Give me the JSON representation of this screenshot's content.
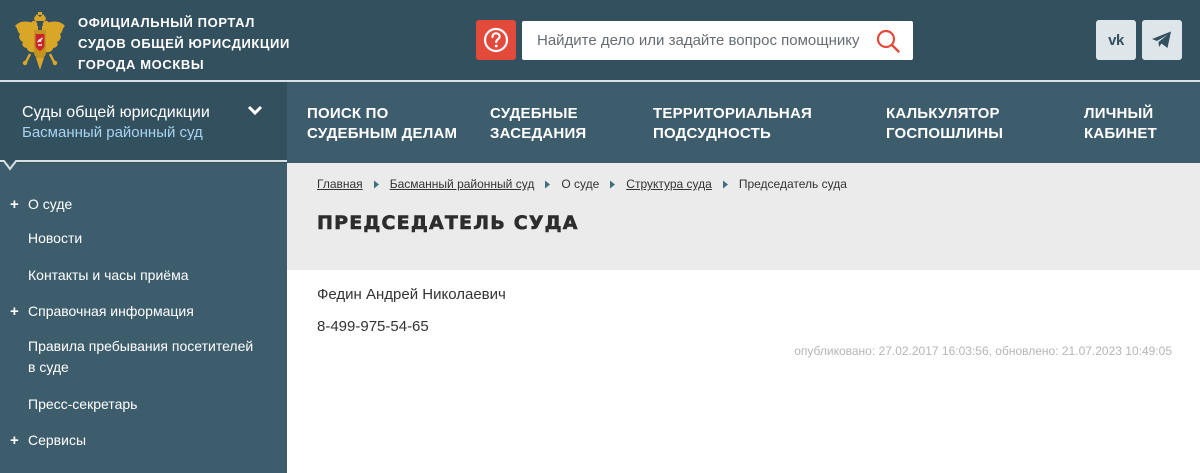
{
  "header": {
    "portal_title": [
      "Официальный портал",
      "судов общей юрисдикции",
      "города Москвы"
    ],
    "search": {
      "placeholder": "Найдите дело или задайте вопрос помощнику"
    },
    "vk_label": "vk"
  },
  "court_selector": {
    "line1": "Суды общей юрисдикции",
    "line2": "Басманный районный суд"
  },
  "main_nav": [
    {
      "lines": [
        "Поиск по",
        "судебным делам"
      ]
    },
    {
      "lines": [
        "Судебные",
        "заседания"
      ]
    },
    {
      "lines": [
        "Территориальная",
        "подсудность"
      ]
    },
    {
      "lines": [
        "Калькулятор",
        "госпошлины"
      ]
    },
    {
      "lines": [
        "Личный",
        "кабинет"
      ]
    }
  ],
  "sidebar": {
    "items": [
      {
        "label": "О суде",
        "expandable": true
      },
      {
        "label": "Новости",
        "expandable": false
      },
      {
        "label": "Контакты и часы приёма",
        "expandable": false
      },
      {
        "label": "Справочная информация",
        "expandable": true
      },
      {
        "label": "Правила пребывания посетителей в суде",
        "lines": [
          "Правила пребывания посетителей",
          "в суде"
        ],
        "expandable": false
      },
      {
        "label": "Пресс-секретарь",
        "expandable": false
      },
      {
        "label": "Сервисы",
        "expandable": true
      }
    ]
  },
  "breadcrumb": {
    "items": [
      "Главная",
      "Басманный районный суд",
      "О суде",
      "Структура суда",
      "Председатель суда"
    ]
  },
  "page": {
    "title": "Председатель суда",
    "person_name": "Федин Андрей Николаевич",
    "phone": "8-499-975-54-65",
    "timestamp": "опубликовано: 27.02.2017 16:03:56, обновлено: 21.07.2023 10:49:05"
  },
  "colors": {
    "header_bg": "#33505f",
    "nav_bg": "#3d5d6d",
    "accent_red": "#e24a3b",
    "link_blue": "#a9d3ef"
  },
  "icons": [
    "coat-of-arms-icon",
    "question-icon",
    "search-icon",
    "vk-icon",
    "telegram-icon",
    "chevron-down-icon",
    "plus-icon",
    "breadcrumb-arrow-icon"
  ]
}
